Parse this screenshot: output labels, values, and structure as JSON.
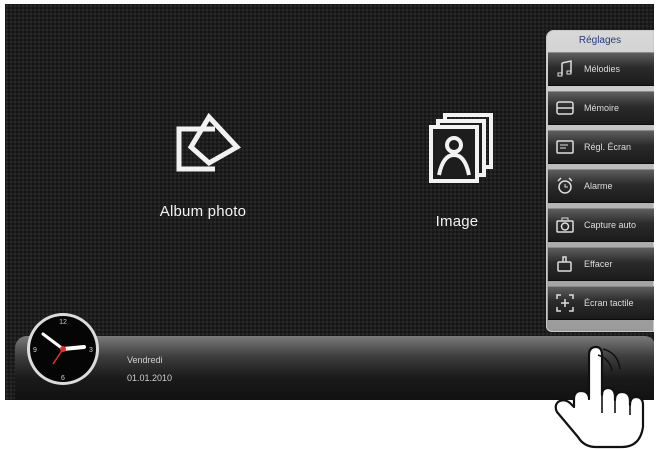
{
  "home": {
    "tiles": [
      {
        "label": "Album photo",
        "icon": "album-photo-icon"
      },
      {
        "label": "Image",
        "icon": "image-icon"
      }
    ]
  },
  "menu": {
    "title": "Réglages",
    "items": [
      {
        "label": "Mélodies",
        "icon": "music-note-icon"
      },
      {
        "label": "Mémoire",
        "icon": "memory-icon"
      },
      {
        "label": "Régl. Écran",
        "icon": "screen-settings-icon"
      },
      {
        "label": "Alarme",
        "icon": "alarm-clock-icon"
      },
      {
        "label": "Capture auto",
        "icon": "camera-icon"
      },
      {
        "label": "Effacer",
        "icon": "delete-hand-icon"
      },
      {
        "label": "Écran tactile",
        "icon": "touch-screen-icon"
      }
    ]
  },
  "status_bar": {
    "day": "Vendredi",
    "date": "01.01.2010",
    "clock_numerals": [
      "12",
      "3",
      "6",
      "9"
    ]
  }
}
